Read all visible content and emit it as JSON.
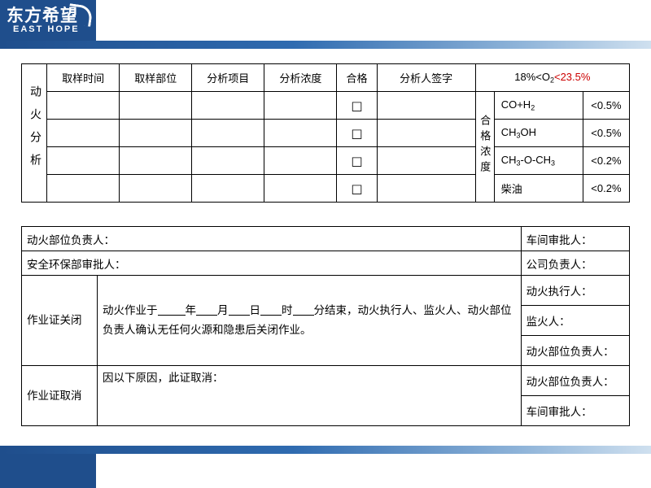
{
  "logo": {
    "chinese": "东方希望",
    "english": "EAST HOPE",
    "swoosh_icon": "swoosh-icon",
    "brand_color": "#1f4e8c"
  },
  "analysis_table": {
    "side_label": "动火分析",
    "headers": {
      "time": "取样时间",
      "part": "取样部位",
      "item": "分析项目",
      "concentration": "分析浓度",
      "pass": "合格",
      "signature": "分析人签字"
    },
    "pass_checkbox": "□",
    "rows": [
      {
        "time": "",
        "part": "",
        "item": "",
        "concentration": "",
        "pass": "□",
        "signature": ""
      },
      {
        "time": "",
        "part": "",
        "item": "",
        "concentration": "",
        "pass": "□",
        "signature": ""
      },
      {
        "time": "",
        "part": "",
        "item": "",
        "concentration": "",
        "pass": "□",
        "signature": ""
      },
      {
        "time": "",
        "part": "",
        "item": "",
        "concentration": "",
        "pass": "□",
        "signature": ""
      }
    ],
    "limits": {
      "o2_header_prefix": "18%<O",
      "o2_header_sub": "2",
      "o2_header_red": "<23.5%",
      "side_label": "合格浓度",
      "items": [
        {
          "name_prefix": "CO+H",
          "name_sub": "2",
          "name_suffix": "",
          "value": "<0.5%"
        },
        {
          "name_prefix": "CH",
          "name_sub": "3",
          "name_suffix": "OH",
          "value": "<0.5%"
        },
        {
          "name_prefix": "CH",
          "name_sub": "3",
          "name_suffix": "-O-CH",
          "name_sub2": "3",
          "value": "<0.2%"
        },
        {
          "name_prefix": "柴油",
          "name_sub": "",
          "name_suffix": "",
          "value": "<0.2%"
        }
      ]
    }
  },
  "signoff_table": {
    "row1_left": "动火部位负责人：",
    "row1_right": "车间审批人：",
    "row2_left": "安全环保部审批人：",
    "row2_right": "公司负责人：",
    "close_label": "作业证关闭",
    "close_text_a": "动火作业于",
    "close_text_b": "年",
    "close_text_c": "月",
    "close_text_d": "日",
    "close_text_e": "时",
    "close_text_f": "分结束，动火执行人、监火人、动火部位负责人确认无任何火源和隐患后关闭作业。",
    "close_right_1": "动火执行人：",
    "close_right_2": "监火人：",
    "close_right_3": "动火部位负责人：",
    "cancel_label": "作业证取消",
    "cancel_text": "因以下原因，此证取消：",
    "cancel_right_1": "动火部位负责人：",
    "cancel_right_2": "车间审批人："
  }
}
